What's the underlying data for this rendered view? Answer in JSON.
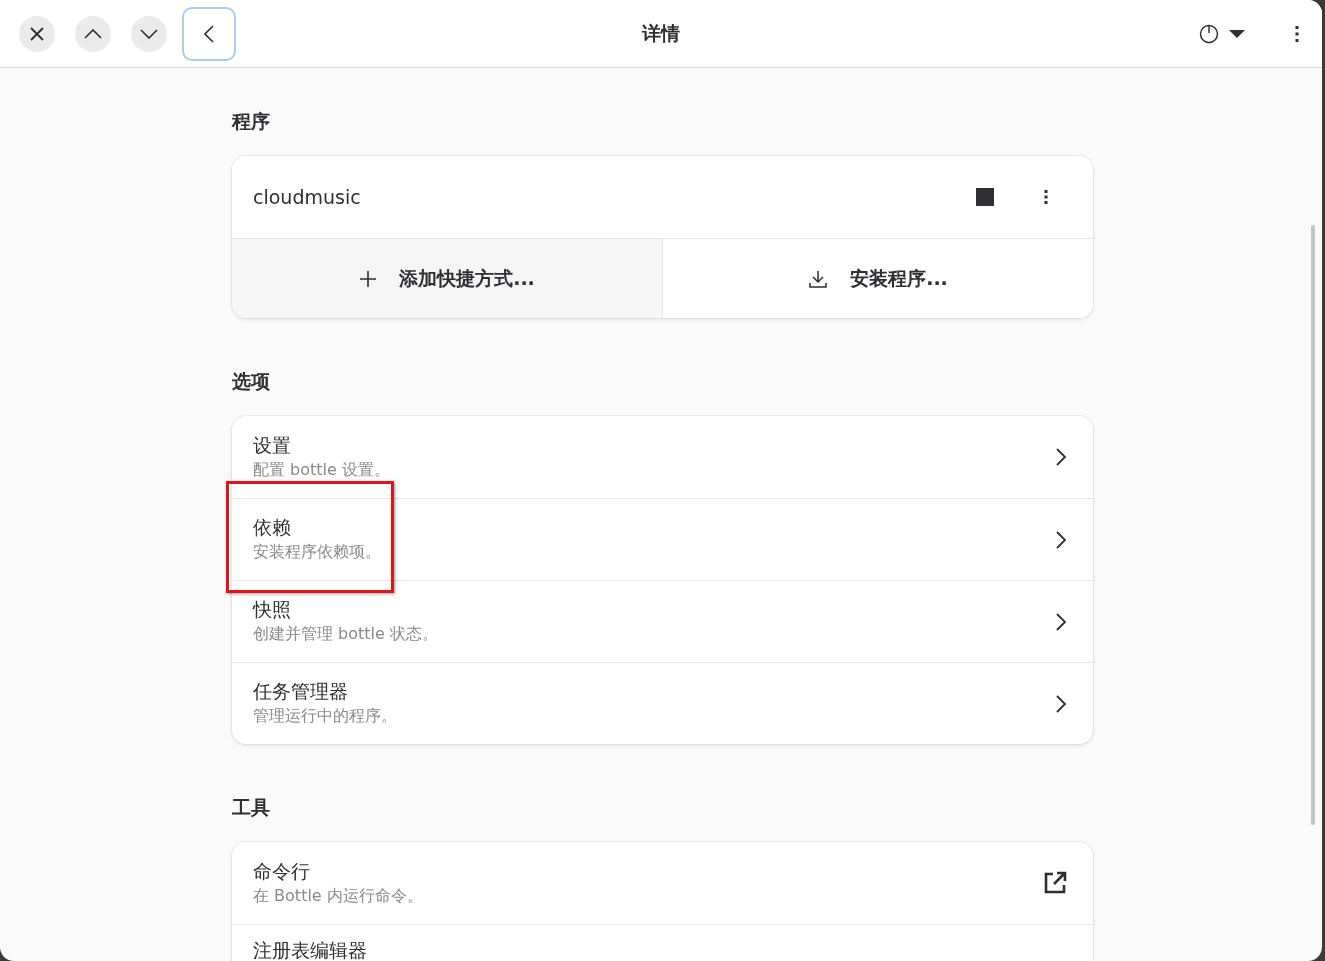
{
  "header": {
    "title": "详情"
  },
  "program_section": {
    "title": "程序",
    "program": {
      "name": "cloudmusic"
    },
    "actions": [
      {
        "label": "添加快捷方式...",
        "kind": "plus",
        "hovered": true
      },
      {
        "label": "安装程序...",
        "kind": "download",
        "hovered": false
      }
    ]
  },
  "options_section": {
    "title": "选项",
    "rows": [
      {
        "title": "设置",
        "subtitle": "配置 bottle 设置。",
        "kind": "chevron",
        "highlighted": false
      },
      {
        "title": "依赖",
        "subtitle": "安装程序依赖项。",
        "kind": "chevron",
        "highlighted": true
      },
      {
        "title": "快照",
        "subtitle": "创建并管理 bottle 状态。",
        "kind": "chevron",
        "highlighted": false
      },
      {
        "title": "任务管理器",
        "subtitle": "管理运行中的程序。",
        "kind": "chevron",
        "highlighted": false
      }
    ]
  },
  "tools_section": {
    "title": "工具",
    "rows": [
      {
        "title": "命令行",
        "subtitle": "在 Bottle 内运行命令。",
        "kind": "external",
        "highlighted": false
      },
      {
        "title": "注册表编辑器",
        "highlighted": false
      }
    ]
  }
}
